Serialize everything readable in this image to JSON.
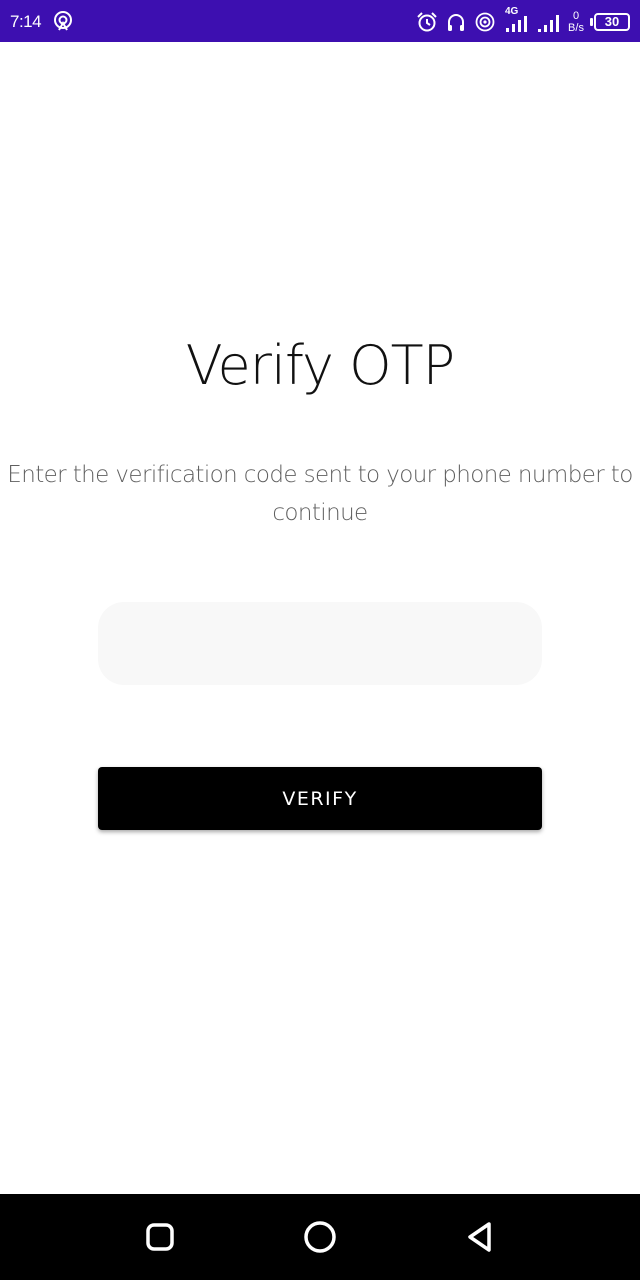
{
  "status_bar": {
    "time": "7:14",
    "network_tag": "4G",
    "netspeed_value": "0",
    "netspeed_unit": "B/s",
    "battery_level": "30",
    "background_color": "#3d0fb0",
    "icons": [
      "cast-icon",
      "alarm-icon",
      "headphones-icon",
      "hotspot-icon",
      "signal-4g-icon",
      "signal-icon",
      "battery-icon"
    ]
  },
  "main": {
    "title": "Verify OTP",
    "subtitle": "Enter the verification code sent to your phone number to continue",
    "otp_input": {
      "value": "",
      "placeholder": ""
    },
    "verify_button_label": "VERIFY"
  },
  "nav_bar": {
    "icons": [
      "recents-icon",
      "home-icon",
      "back-icon"
    ]
  }
}
